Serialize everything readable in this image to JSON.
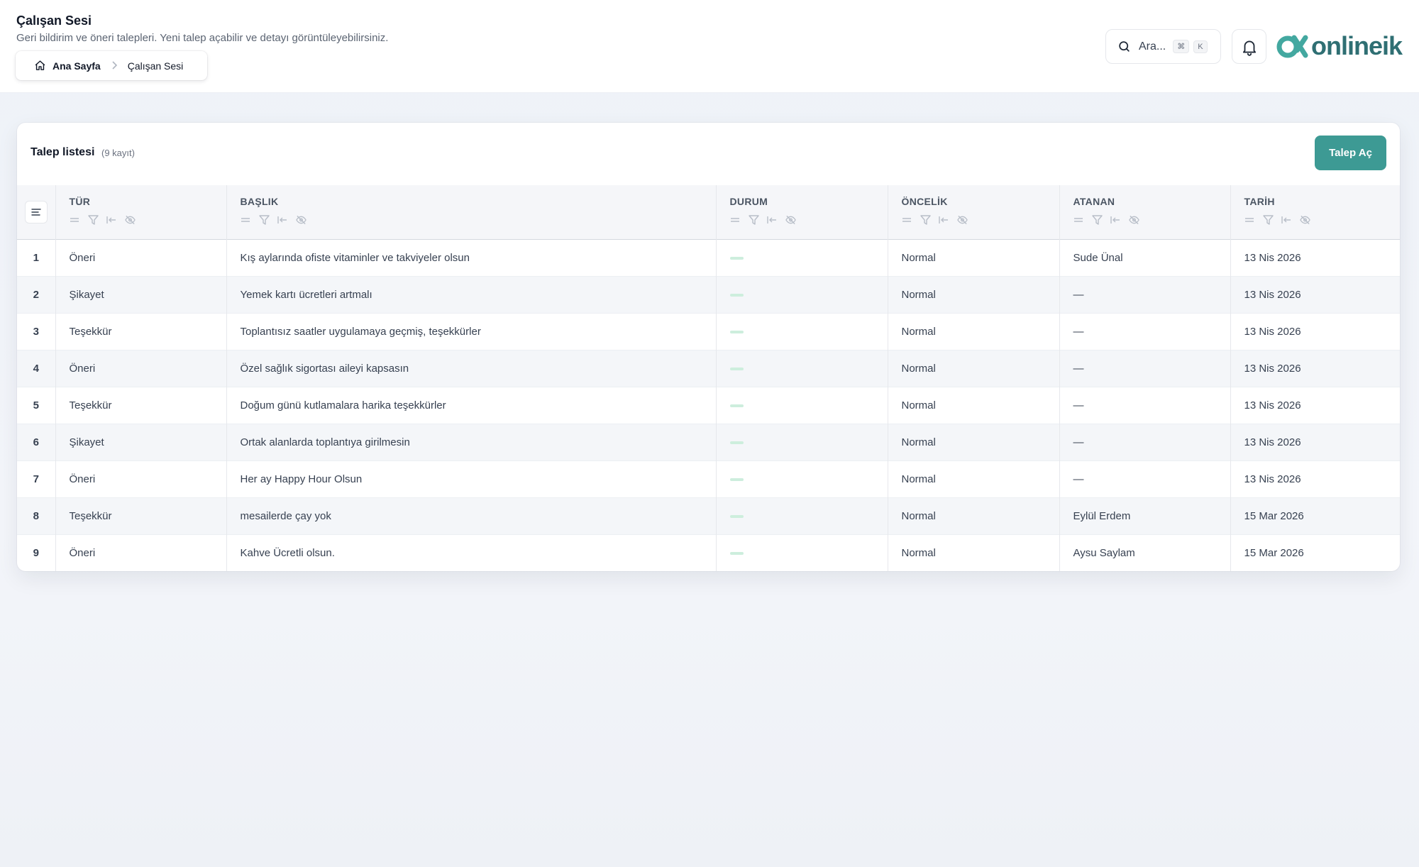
{
  "header": {
    "title": "Çalışan Sesi",
    "subtitle": "Geri bildirim ve öneri talepleri. Yeni talep açabilir ve detayı görüntüleyebilirsiniz.",
    "breadcrumb": {
      "home": "Ana Sayfa",
      "current": "Çalışan Sesi"
    },
    "search": {
      "placeholder": "Ara...",
      "shortcut_mod": "⌘",
      "shortcut_key": "K"
    },
    "logo_text": "onlineik"
  },
  "card": {
    "title": "Talep listesi",
    "count": "(9 kayıt)",
    "new_button": "Talep Aç"
  },
  "table": {
    "columns": [
      "TÜR",
      "BAŞLIK",
      "DURUM",
      "ÖNCELİK",
      "ATANAN",
      "TARİH"
    ],
    "rows": [
      {
        "no": "1",
        "tur": "Öneri",
        "baslik": "Kış aylarında ofiste vitaminler ve takviyeler olsun",
        "oncelik": "Normal",
        "atanan": "Sude Ünal",
        "tarih": "13 Nis 2026"
      },
      {
        "no": "2",
        "tur": "Şikayet",
        "baslik": "Yemek kartı ücretleri artmalı",
        "oncelik": "Normal",
        "atanan": "—",
        "tarih": "13 Nis 2026"
      },
      {
        "no": "3",
        "tur": "Teşekkür",
        "baslik": "Toplantısız saatler uygulamaya geçmiş, teşekkürler",
        "oncelik": "Normal",
        "atanan": "—",
        "tarih": "13 Nis 2026"
      },
      {
        "no": "4",
        "tur": "Öneri",
        "baslik": "Özel sağlık sigortası aileyi kapsasın",
        "oncelik": "Normal",
        "atanan": "—",
        "tarih": "13 Nis 2026"
      },
      {
        "no": "5",
        "tur": "Teşekkür",
        "baslik": "Doğum günü kutlamalara harika teşekkürler",
        "oncelik": "Normal",
        "atanan": "—",
        "tarih": "13 Nis 2026"
      },
      {
        "no": "6",
        "tur": "Şikayet",
        "baslik": "Ortak alanlarda toplantıya girilmesin",
        "oncelik": "Normal",
        "atanan": "—",
        "tarih": "13 Nis 2026"
      },
      {
        "no": "7",
        "tur": "Öneri",
        "baslik": "Her ay Happy Hour Olsun",
        "oncelik": "Normal",
        "atanan": "—",
        "tarih": "13 Nis 2026"
      },
      {
        "no": "8",
        "tur": "Teşekkür",
        "baslik": "mesailerde çay yok",
        "oncelik": "Normal",
        "atanan": "Eylül Erdem",
        "tarih": "15 Mar 2026"
      },
      {
        "no": "9",
        "tur": "Öneri",
        "baslik": "Kahve Ücretli olsun.",
        "oncelik": "Normal",
        "atanan": "Aysu Saylam",
        "tarih": "15 Mar 2026"
      }
    ]
  },
  "colors": {
    "accent": "#3d9a94",
    "logo": "#2f6f73",
    "status": "#cdeedd"
  },
  "icons": [
    "home-icon",
    "chevron-right-icon",
    "search-icon",
    "bell-icon",
    "menu-lines-icon",
    "drag-handle-icon",
    "filter-icon",
    "pin-icon",
    "eye-off-icon"
  ]
}
